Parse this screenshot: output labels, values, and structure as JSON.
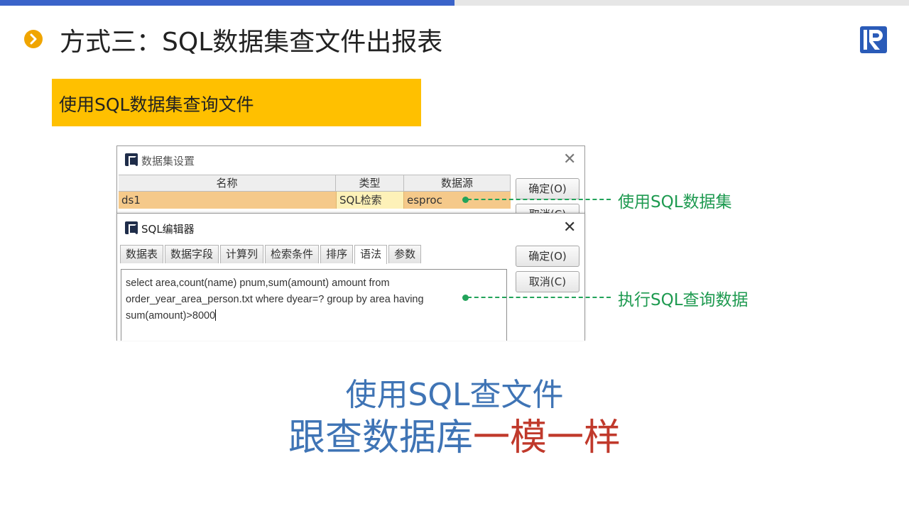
{
  "slide": {
    "title": "方式三：SQL数据集查文件出报表",
    "banner": "使用SQL数据集查询文件",
    "caption_line1": "使用SQL查文件",
    "caption_line2_part1": "跟查数据库",
    "caption_line2_part2": "一模一样",
    "colors": {
      "accent_blue": "#3a63c9",
      "banner_yellow": "#ffc000",
      "annotation_green": "#22a35a",
      "caption_blue": "#3f74b5",
      "caption_red": "#c0392b"
    }
  },
  "dataset_window": {
    "title": "数据集设置",
    "columns": [
      "名称",
      "类型",
      "数据源"
    ],
    "rows": [
      {
        "name": "ds1",
        "type": "SQL检索",
        "source": "esproc"
      }
    ],
    "ok_button": "确定(O)",
    "cancel_button": "取消(C)"
  },
  "sql_editor": {
    "title": "SQL编辑器",
    "tabs": [
      "数据表",
      "数据字段",
      "计算列",
      "检索条件",
      "排序",
      "语法",
      "参数"
    ],
    "active_tab": "语法",
    "sql_lines": [
      "select area,count(name) pnum,sum(amount) amount from",
      "order_year_area_person.txt where dyear=? group by area having",
      "sum(amount)>8000"
    ],
    "ok_button": "确定(O)",
    "cancel_button": "取消(C)"
  },
  "annotations": {
    "dataset": "使用SQL数据集",
    "query": "执行SQL查询数据"
  }
}
